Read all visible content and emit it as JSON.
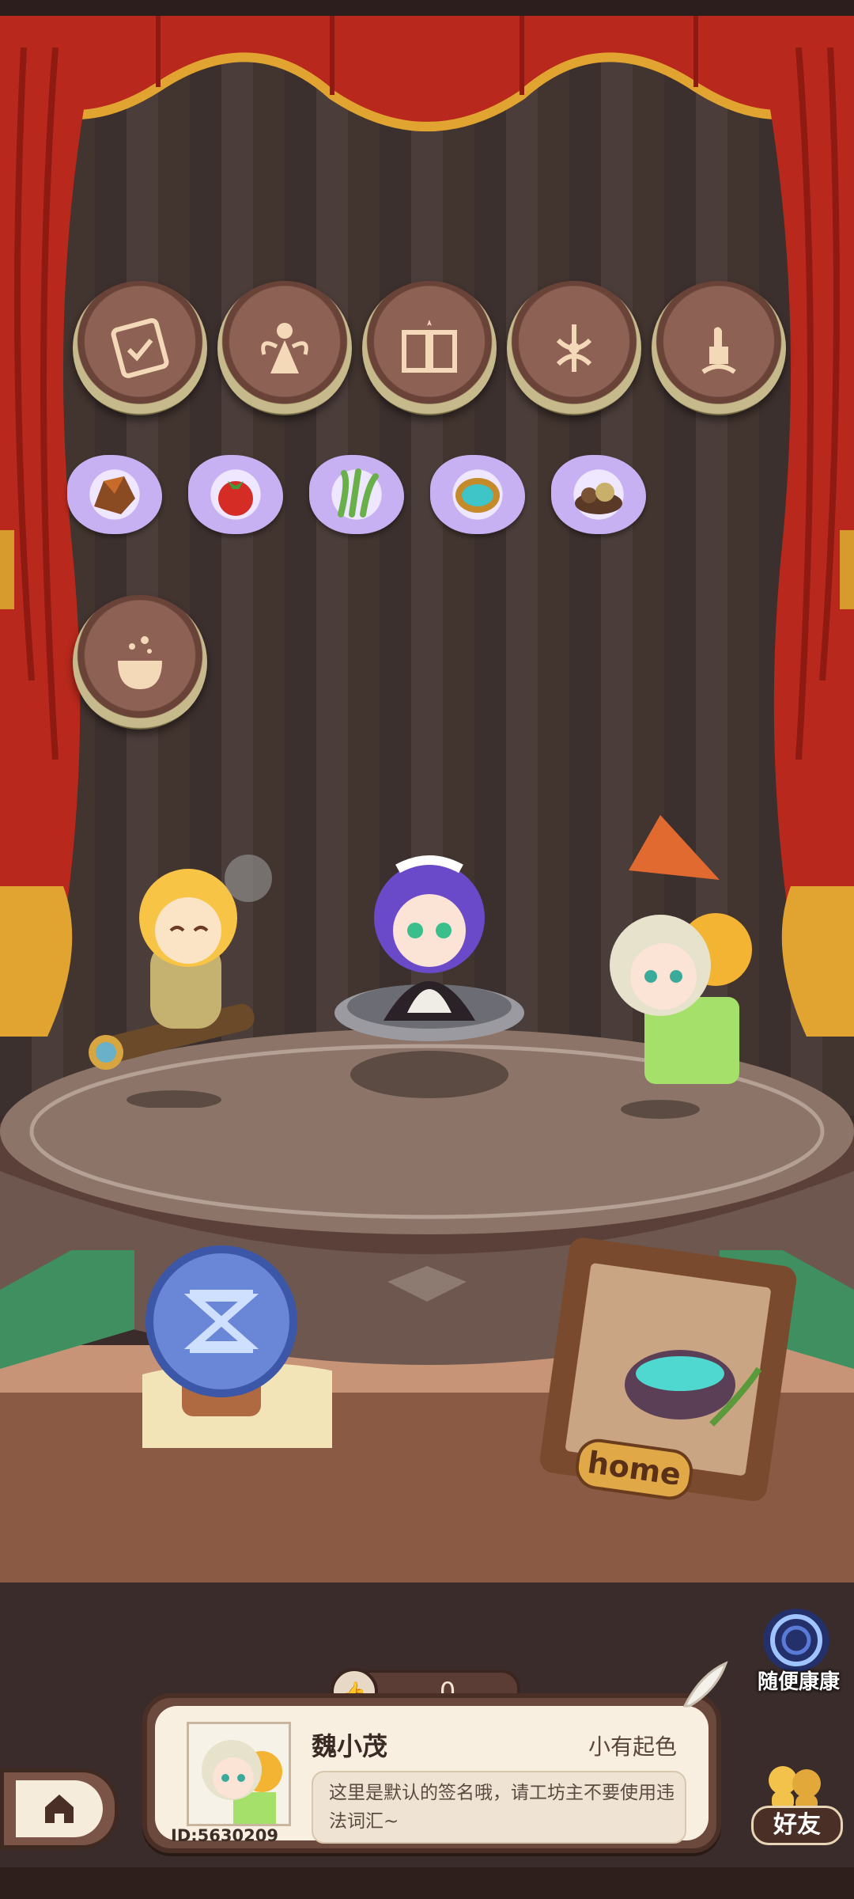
{
  "badges_row1": [
    {
      "icon": "certificate-icon"
    },
    {
      "icon": "fairy-icon"
    },
    {
      "icon": "book-icon"
    },
    {
      "icon": "ornament-icon"
    },
    {
      "icon": "thumb-flower-icon"
    }
  ],
  "materials_row": [
    {
      "icon": "ore-icon"
    },
    {
      "icon": "tomato-icon"
    },
    {
      "icon": "herb-icon"
    },
    {
      "icon": "gem-icon"
    },
    {
      "icon": "soil-icon"
    }
  ],
  "badges_row3": [
    {
      "icon": "cauldron-icon"
    }
  ],
  "stage": {
    "frame_label": "home"
  },
  "likes": {
    "count": "0"
  },
  "profile": {
    "name": "魏小茂",
    "title": "小有起色",
    "id": "ID:5630209",
    "signature": "这里是默认的签名哦，请工坊主不要使用违法词汇~"
  },
  "side": {
    "random_label": "随便康康",
    "friends_label": "好友"
  },
  "colors": {
    "curtain": "#b8281c",
    "curtain_trim": "#e2a431",
    "wall": "#42342f",
    "stage": "#8a6a5c"
  }
}
